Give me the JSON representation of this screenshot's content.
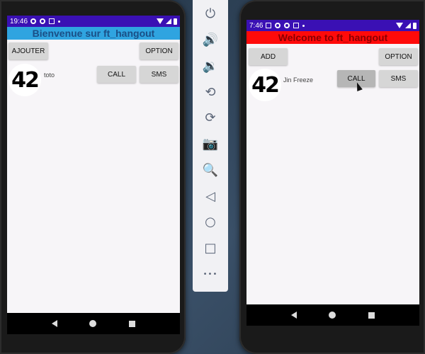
{
  "left_device": {
    "status_time": "19:46",
    "app_title": "Bienvenue sur ft_hangout",
    "add_label": "AJOUTER",
    "option_label": "OPTION",
    "contact": {
      "logo_text": "42",
      "name": "toto",
      "call_label": "CALL",
      "sms_label": "SMS"
    }
  },
  "right_device": {
    "status_time": "7:46",
    "app_title": "Welcome to ft_hangout",
    "add_label": "ADD",
    "option_label": "OPTION",
    "contact": {
      "logo_text": "42",
      "name": "Jin Freeze",
      "call_label": "CALL",
      "sms_label": "SMS"
    }
  },
  "emulator_toolbar": {
    "tools": [
      {
        "name": "power-icon",
        "glyph": "⏻"
      },
      {
        "name": "volume-up-icon",
        "glyph": "🔊"
      },
      {
        "name": "volume-down-icon",
        "glyph": "🔉"
      },
      {
        "name": "rotate-left-icon",
        "glyph": "⟲"
      },
      {
        "name": "rotate-right-icon",
        "glyph": "⟳"
      },
      {
        "name": "camera-icon",
        "glyph": "📷"
      },
      {
        "name": "zoom-icon",
        "glyph": "🔍"
      },
      {
        "name": "back-icon",
        "glyph": "◁"
      },
      {
        "name": "home-icon",
        "glyph": "○"
      },
      {
        "name": "overview-icon",
        "glyph": "□"
      },
      {
        "name": "more-icon",
        "glyph": "•••"
      }
    ]
  },
  "colors": {
    "left_titlebar": "#2fa4e0",
    "right_titlebar": "#ff0a0a",
    "statusbar": "#3a10b4"
  }
}
